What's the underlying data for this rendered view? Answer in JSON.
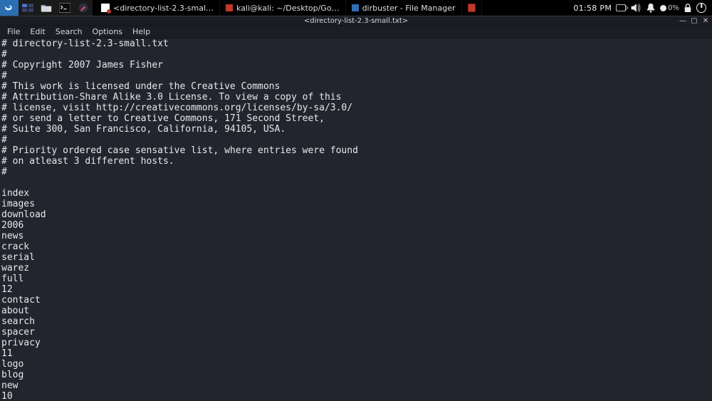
{
  "taskbar": {
    "tasks": [
      {
        "icon": "mousepad",
        "label": "<directory-list-2.3-smal…"
      },
      {
        "icon": "red",
        "label": "kali@kali: ~/Desktop/Go…"
      },
      {
        "icon": "blue",
        "label": "dirbuster - File Manager"
      }
    ],
    "clock": "01:58 PM",
    "battery_pct": "0%"
  },
  "editor": {
    "title": "<directory-list-2.3-small.txt>",
    "menus": [
      "File",
      "Edit",
      "Search",
      "Options",
      "Help"
    ],
    "window_buttons": {
      "min": "—",
      "max": "▢",
      "close": "✕"
    },
    "content": "# directory-list-2.3-small.txt\n#\n# Copyright 2007 James Fisher\n#\n# This work is licensed under the Creative Commons\n# Attribution-Share Alike 3.0 License. To view a copy of this\n# license, visit http://creativecommons.org/licenses/by-sa/3.0/\n# or send a letter to Creative Commons, 171 Second Street,\n# Suite 300, San Francisco, California, 94105, USA.\n#\n# Priority ordered case sensative list, where entries were found\n# on atleast 3 different hosts.\n#\n\nindex\nimages\ndownload\n2006\nnews\ncrack\nserial\nwarez\nfull\n12\ncontact\nabout\nsearch\nspacer\nprivacy\n11\nlogo\nblog\nnew\n10"
  }
}
